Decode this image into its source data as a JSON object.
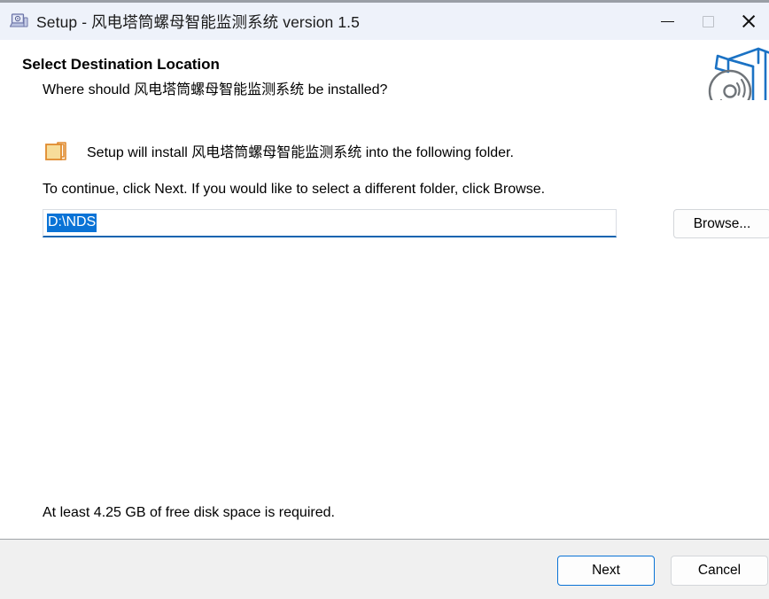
{
  "window": {
    "title": "Setup - 风电塔筒螺母智能监测系统 version 1.5",
    "icon": "setup-computer-icon",
    "controls": {
      "minimize_label": "Minimize",
      "maximize_label": "Maximize",
      "close_label": "Close"
    },
    "titlebar_color": "#eef2fa"
  },
  "header": {
    "title": "Select Destination Location",
    "subtitle": "Where should 风电塔筒螺母智能监测系统 be installed?",
    "logo": "setup-box-disc-icon",
    "logo_box_color": "#1b72c4",
    "logo_disc_color": "#6f7479"
  },
  "main": {
    "folder_icon": "folder-icon",
    "folder_icon_color": "#e08a2e",
    "install_note": "Setup will install 风电塔筒螺母智能监测系统 into the following folder.",
    "continue_note": "To continue, click Next. If you would like to select a different folder, click Browse.",
    "path_input": {
      "value": "D:\\NDS",
      "placeholder": "",
      "selected": true,
      "selection_color": "#0a73d6",
      "focus_border_color": "#1064b0"
    },
    "browse_label": "Browse...",
    "disk_note": "At least 4.25 GB of free disk space is required."
  },
  "footer": {
    "next_label": "Next",
    "cancel_label": "Cancel",
    "next_accent_color": "#0a73d6"
  }
}
